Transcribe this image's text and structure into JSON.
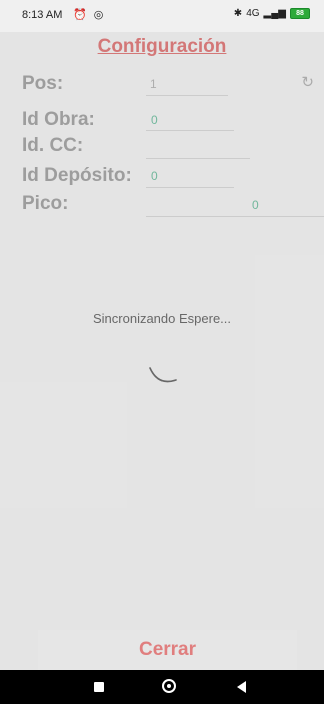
{
  "status_bar": {
    "time": "8:13 AM",
    "left_icons": [
      "alarm-icon",
      "target-icon"
    ],
    "right_icons": [
      "bluetooth-icon",
      "signal-icon",
      "battery-icon"
    ],
    "network": "4G",
    "battery_level": "88"
  },
  "header": {
    "title": "Configuración"
  },
  "form": {
    "fields": [
      {
        "label": "Pos:",
        "value": "1"
      },
      {
        "label": "Id Obra:",
        "value": "0"
      },
      {
        "label": "Id. CC:",
        "value": ""
      },
      {
        "label": "Id Depósito:",
        "value": "0"
      },
      {
        "label": "Pico:",
        "value": "0"
      }
    ],
    "refresh_icon": "refresh-icon"
  },
  "sync": {
    "message": "Sincronizando Espere..."
  },
  "footer": {
    "close_label": "Cerrar"
  },
  "nav": {
    "icons": [
      "recents-icon",
      "home-icon",
      "back-icon"
    ]
  },
  "colors": {
    "accent": "#e07e7e",
    "label": "#a7a7a7",
    "value_green": "#79c2a6"
  }
}
